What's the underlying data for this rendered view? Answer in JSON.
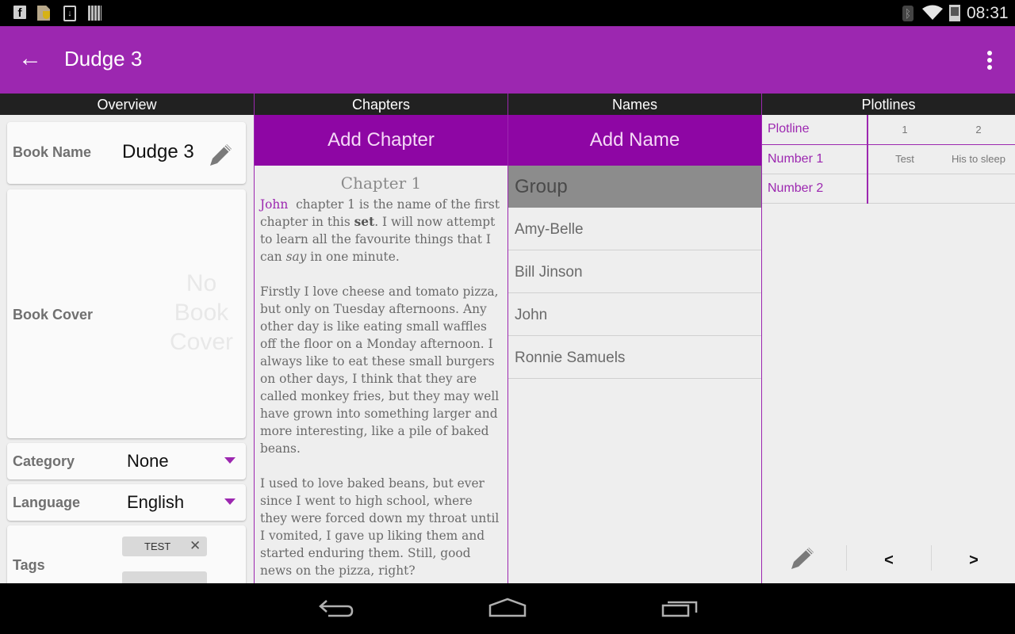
{
  "status_bar": {
    "notification_icons": [
      "facebook-icon",
      "document-shield-icon",
      "download-icon",
      "barcode-icon"
    ],
    "system_icons": [
      "bluetooth-icon",
      "wifi-icon",
      "battery-charging-icon"
    ],
    "time": "08:31",
    "fb_glyph": "f",
    "download_glyph": "↓",
    "bt_glyph": "ᛒ"
  },
  "app_bar": {
    "title": "Dudge 3",
    "back_glyph": "←",
    "color": "#9c27b0"
  },
  "columns": {
    "overview": "Overview",
    "chapters": "Chapters",
    "names": "Names",
    "plotlines": "Plotlines"
  },
  "overview": {
    "book_name_label": "Book Name",
    "book_name_value": "Dudge 3",
    "book_cover_label": "Book Cover",
    "no_cover_text": "No Book Cover",
    "category_label": "Category",
    "category_value": "None",
    "language_label": "Language",
    "language_value": "English",
    "tags_label": "Tags",
    "tags": [
      "TEST"
    ],
    "tag_remove_glyph": "✕"
  },
  "chapters": {
    "add_label": "Add Chapter",
    "chapter_title": "Chapter 1",
    "p1": {
      "name_link": "John",
      "text_a": " chapter 1 is the name of the first chapter in this ",
      "bold": "set",
      "text_b": ". I will now attempt to learn all the favourite things that I can ",
      "italic": "say",
      "text_c": " in one minute."
    },
    "p2": "Firstly I love cheese and tomato pizza, but only on Tuesday afternoons. Any other day is like eating small waffles off the floor on a Monday afternoon. I always like to eat these small burgers on other days, I think that they are called monkey fries, but they may well have grown into something larger and more interesting, like a pile of baked beans.",
    "p3": "I used to love baked beans, but ever since I went to high school, where they were forced down my throat until I vomited, I gave up liking them and started enduring them.  Still, good news on the pizza, right?"
  },
  "names": {
    "add_label": "Add Name",
    "group_label": "Group",
    "items": [
      "Amy-Belle",
      "Bill Jinson",
      "John",
      "Ronnie Samuels"
    ]
  },
  "plotlines": {
    "header_label": "Plotline",
    "columns": [
      "1",
      "2"
    ],
    "rows": [
      {
        "label": "Number 1",
        "cells": [
          "Test",
          "His to sleep"
        ]
      },
      {
        "label": "Number 2",
        "cells": [
          "",
          ""
        ]
      }
    ],
    "prev_label": "<",
    "next_label": ">"
  },
  "colors": {
    "accent": "#9c27b0",
    "add_button": "#8e06a4",
    "group_header": "#8c8c8c"
  }
}
